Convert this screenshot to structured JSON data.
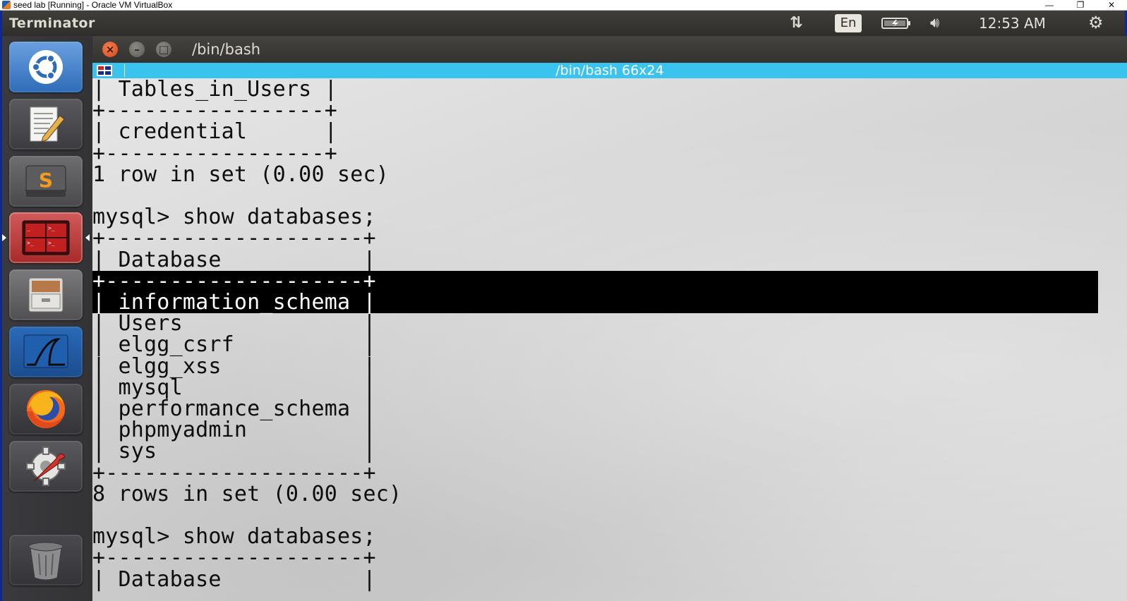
{
  "host": {
    "title": "seed lab [Running] - Oracle VM VirtualBox",
    "controls": [
      "—",
      "❐",
      "✕"
    ]
  },
  "panel": {
    "app_name": "Terminator",
    "keyboard_layout": "En",
    "clock": "12:53 AM",
    "icons": [
      "network-transfer-icon",
      "battery-icon",
      "volume-icon",
      "power-gear-icon"
    ]
  },
  "launcher": {
    "items": [
      {
        "name": "dash-home",
        "icon": "ubuntu-logo-icon"
      },
      {
        "name": "text-editor",
        "icon": "text-editor-icon"
      },
      {
        "name": "sublime-text",
        "icon": "sublime-s-icon"
      },
      {
        "name": "terminator",
        "icon": "terminator-icon",
        "active": true
      },
      {
        "name": "files",
        "icon": "file-cabinet-icon"
      },
      {
        "name": "wireshark",
        "icon": "wireshark-fin-icon"
      },
      {
        "name": "firefox",
        "icon": "firefox-icon"
      },
      {
        "name": "system-settings",
        "icon": "settings-wrench-icon"
      },
      {
        "name": "trash",
        "icon": "trash-icon"
      }
    ]
  },
  "window": {
    "title": "/bin/bash",
    "tab_title": "/bin/bash 66x24"
  },
  "terminal": {
    "lines": [
      "| Tables_in_Users |",
      "+-----------------+",
      "| credential      |",
      "+-----------------+",
      "1 row in set (0.00 sec)",
      "",
      "mysql> show databases;",
      "+--------------------+",
      "| Database           |",
      "+--------------------+",
      "| information_schema |",
      "| Users              |",
      "| elgg_csrf          |",
      "| elgg_xss           |",
      "| mysql              |",
      "| performance_schema |",
      "| phpmyadmin         |",
      "| sys                |",
      "+--------------------+",
      "8 rows in set (0.00 sec)",
      "",
      "mysql> show databases;",
      "+--------------------+",
      "| Database           |"
    ],
    "selected_line_indices": [
      9,
      10
    ]
  },
  "colors": {
    "panel_bg": "#3a3935",
    "header_bg": "#3ac3ef",
    "selection_bg": "#000000",
    "text": "#0e0e0e",
    "vm_frame": "#0c2a8f"
  }
}
